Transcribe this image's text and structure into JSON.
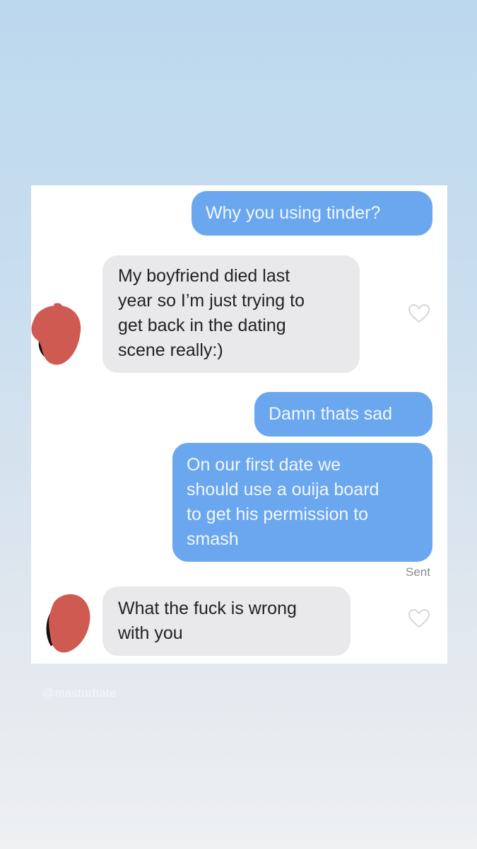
{
  "messages": [
    {
      "direction": "outgoing",
      "text": "Why you using tinder?"
    },
    {
      "direction": "incoming",
      "text": "My boyfriend died last\nyear so I’m just trying to\nget back in the dating\nscene really:)"
    },
    {
      "direction": "outgoing",
      "text": "Damn thats sad"
    },
    {
      "direction": "outgoing",
      "text": "On our first date we\nshould use a ouija board\nto get his permission to\nsmash"
    },
    {
      "direction": "incoming",
      "text": "What the fuck is wrong\nwith you"
    }
  ],
  "status": {
    "sent_label": "Sent"
  },
  "watermark": {
    "handle": "@masturbate"
  },
  "colors": {
    "outgoing_bubble": "#6aa7ee",
    "incoming_bubble": "#e9e9ec",
    "redaction": "#cf5a52",
    "background_top": "#bcd8ee",
    "background_bottom": "#eef0f2"
  },
  "icons": [
    "heart-outline-icon",
    "avatar-redacted"
  ]
}
